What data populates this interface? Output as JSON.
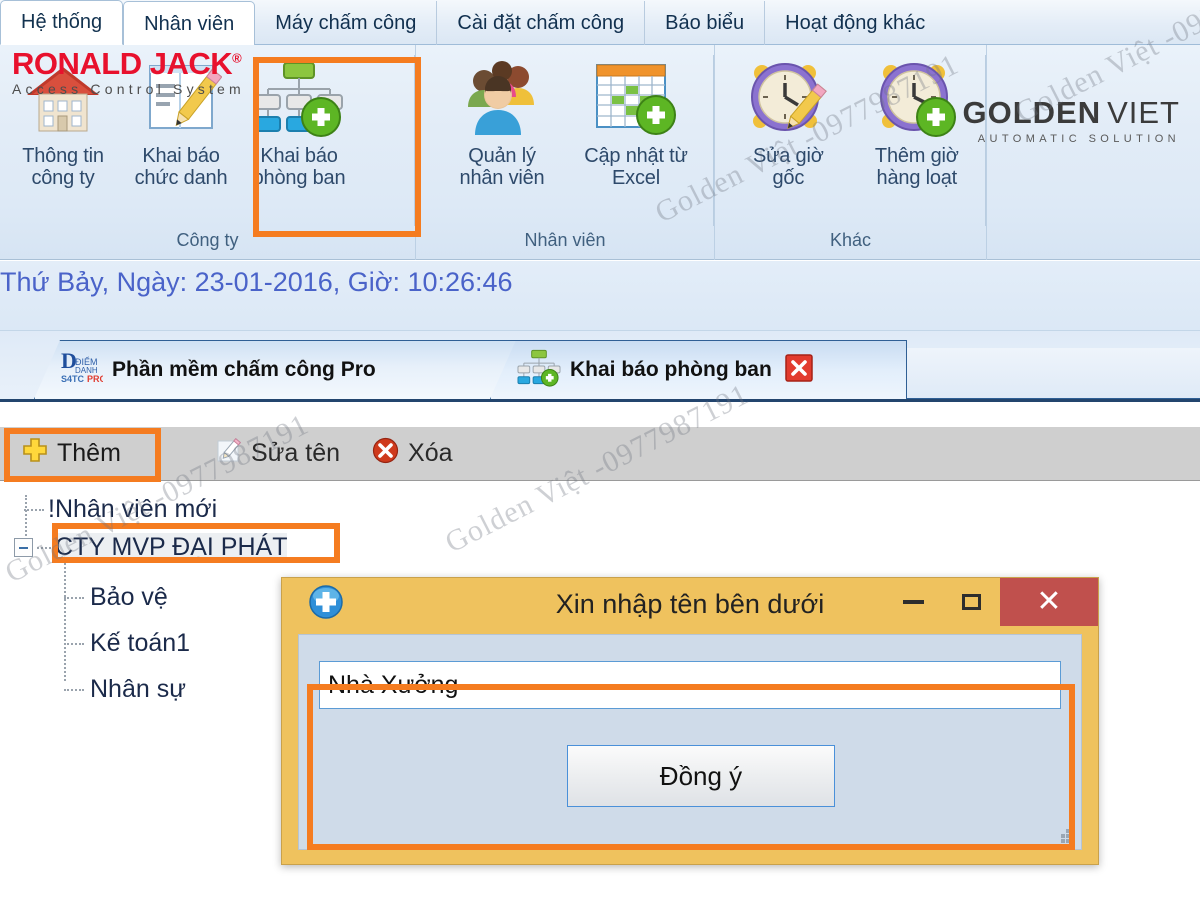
{
  "menubar": {
    "tabs": [
      {
        "label": "Hệ thống",
        "active": false
      },
      {
        "label": "Nhân viên",
        "active": true
      },
      {
        "label": "Máy chấm công",
        "active": false
      },
      {
        "label": "Cài đặt chấm công",
        "active": false
      },
      {
        "label": "Báo biểu",
        "active": false
      },
      {
        "label": "Hoạt động khác",
        "active": false
      }
    ]
  },
  "brand": {
    "ronald_jack_name": "RONALD JACK",
    "ronald_jack_reg": "®",
    "ronald_jack_tagline": "Access Control System",
    "goldenviet_gold": "GOLDEN",
    "goldenviet_viet": "VIET",
    "goldenviet_tagline": "AUTOMATIC SOLUTION"
  },
  "ribbon": {
    "groups": [
      {
        "label": "Công ty",
        "buttons": [
          {
            "label_line1": "Thông tin",
            "label_line2": "công ty",
            "icon": "house-icon"
          },
          {
            "label_line1": "Khai báo",
            "label_line2": "chức danh",
            "icon": "document-pencil-icon"
          },
          {
            "label_line1": "Khai báo",
            "label_line2": "phòng ban",
            "icon": "org-chart-add-icon",
            "highlighted": true
          }
        ]
      },
      {
        "label": "Nhân viên",
        "buttons": [
          {
            "label_line1": "Quản lý",
            "label_line2": "nhân viên",
            "icon": "users-group-icon"
          },
          {
            "label_line1": "Cập nhật từ",
            "label_line2": "Excel",
            "icon": "spreadsheet-add-icon"
          }
        ]
      },
      {
        "label": "Khác",
        "buttons": [
          {
            "label_line1": "Sửa giờ",
            "label_line2": "gốc",
            "icon": "clock-pencil-icon"
          },
          {
            "label_line1": "Thêm giờ",
            "label_line2": "hàng loạt",
            "icon": "clock-add-icon"
          }
        ]
      }
    ]
  },
  "statusbar": {
    "datetime": "Thứ Bảy, Ngày: 23-01-2016, Giờ: 10:26:46"
  },
  "doctabs": [
    {
      "label": "Phần mềm chấm công Pro",
      "icon": "app-logo-icon",
      "closable": false,
      "active": false
    },
    {
      "label": "Khai báo phòng ban",
      "icon": "org-chart-add-icon",
      "closable": true,
      "close_icon": "close-icon",
      "active": true
    }
  ],
  "toolbar": {
    "add_label": "Thêm",
    "add_icon": "plus-icon",
    "rename_label": "Sửa tên",
    "rename_icon": "pencil-icon",
    "delete_label": "Xóa",
    "delete_icon": "delete-circle-icon"
  },
  "tree": {
    "nodes": [
      {
        "label": "!Nhân viên mới",
        "level": 1,
        "expandable": false,
        "selected": false
      },
      {
        "label": "CTY MVP ĐẠI PHÁT",
        "level": 1,
        "expandable": true,
        "expanded": true,
        "selected": true
      },
      {
        "label": "Bảo vệ",
        "level": 2,
        "expandable": false,
        "selected": false
      },
      {
        "label": "Kế toán1",
        "level": 2,
        "expandable": false,
        "selected": false
      },
      {
        "label": "Nhân sự",
        "level": 2,
        "expandable": false,
        "selected": false
      }
    ]
  },
  "dialog": {
    "title": "Xin nhập tên bên dưới",
    "title_icon": "blue-plus-icon",
    "minimize_label": "–",
    "maximize_label": "□",
    "close_label": "✕",
    "input_value": "Nhà Xưởng",
    "input_placeholder": "",
    "ok_label": "Đồng ý"
  },
  "watermark": {
    "text": "Golden Việt -0977987191"
  },
  "colors": {
    "accent_orange": "#f57c20",
    "dialog_gold": "#efc25e",
    "close_red": "#c0504d",
    "brand_red": "#e8112d",
    "date_blue": "#4a63c9"
  }
}
